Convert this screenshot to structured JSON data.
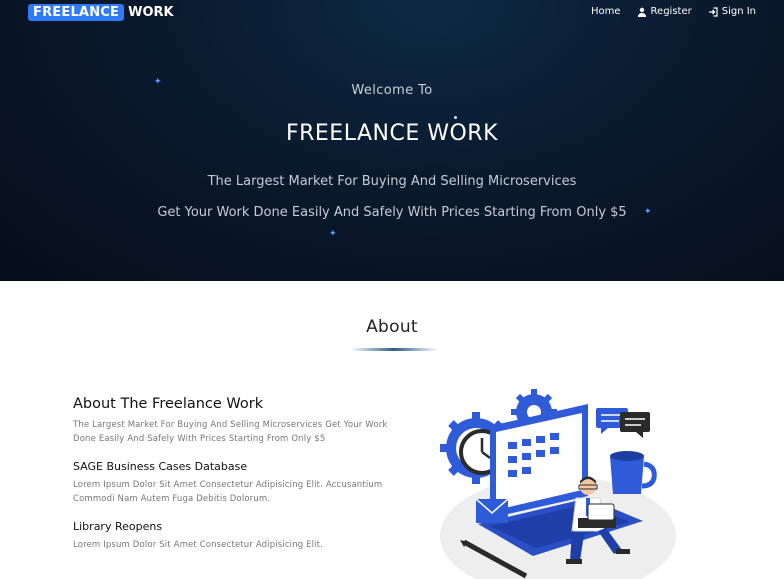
{
  "brand": {
    "highlight": "FREELANCE",
    "rest": "WORK"
  },
  "nav": {
    "home": "Home",
    "register": "Register",
    "signin": "Sign In",
    "register_icon": "user-icon",
    "signin_icon": "sign-in-icon"
  },
  "hero": {
    "welcome": "Welcome To",
    "title": "FREELANCE WORK",
    "tagline1": "The Largest Market For Buying And Selling Microservices",
    "tagline2": "Get Your Work Done Easily And Safely With Prices Starting From Only $5"
  },
  "about": {
    "heading": "About",
    "section_title": "About The Freelance Work",
    "section_text": "The Largest Market For Buying And Selling Microservices Get Your Work Done Easily And Safely With Prices Starting From Only $5",
    "items": [
      {
        "title": "SAGE Business Cases Database",
        "text": "Lorem Ipsum Dolor Sit Amet Consectetur Adipisicing Elit. Accusantium Commodi Nam Autem Fuga Debitis Dolorum."
      },
      {
        "title": "Library Reopens",
        "text": "Lorem Ipsum Dolor Sit Amet Consectetur Adipisicing Elit."
      }
    ]
  },
  "colors": {
    "accent": "#2f7bf5",
    "hero_bg": "#0a1a2e",
    "illus_blue": "#2f5bd9"
  }
}
